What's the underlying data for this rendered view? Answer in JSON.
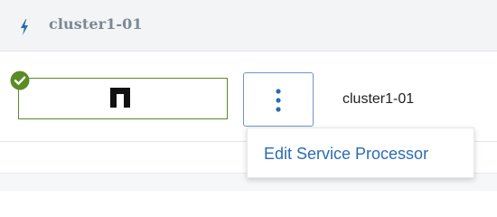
{
  "header": {
    "title": "cluster1-01",
    "icon": "bolt-icon",
    "icon_color": "#2b6cb0"
  },
  "node": {
    "name": "cluster1-01",
    "logo_icon": "netapp-logo-icon",
    "status_icon": "check-circle-icon",
    "status_color": "#5a8b25",
    "border_color": "#5a8b25"
  },
  "actions_button": {
    "icon": "more-vertical-icon",
    "accent_color": "#2b6cb0"
  },
  "menu": {
    "items": [
      {
        "label": "Edit Service Processor"
      }
    ]
  }
}
